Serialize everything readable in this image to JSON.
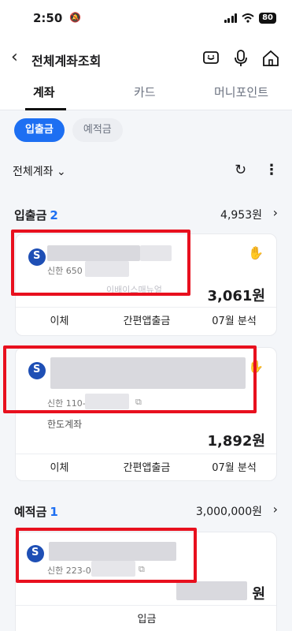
{
  "status_bar": {
    "time": "2:50",
    "battery": "80"
  },
  "header": {
    "title": "전체계좌조회"
  },
  "tabs": [
    {
      "label": "계좌"
    },
    {
      "label": "카드"
    },
    {
      "label": "머니포인트"
    }
  ],
  "chips": [
    {
      "label": "입출금"
    },
    {
      "label": "예적금"
    }
  ],
  "filter": {
    "label": "전체계좌"
  },
  "sections": {
    "checking": {
      "title": "입출금",
      "count": "2",
      "amount": "4,953원"
    },
    "savings": {
      "title": "예적금",
      "count": "1",
      "amount": "3,000,000원"
    }
  },
  "accounts": [
    {
      "number": "신한 650",
      "balance": "3,061원",
      "actions": [
        "이체",
        "간편앱출금",
        "07월 분석"
      ],
      "watermark": "이배이스매뉴얼"
    },
    {
      "number": "신한 110-",
      "sub": "한도계좌",
      "balance": "1,892원",
      "actions": [
        "이체",
        "간편앱출금",
        "07월 분석"
      ]
    },
    {
      "number": "신한 223-0",
      "balance_suffix": "원",
      "action": "입금"
    }
  ],
  "colors": {
    "accent": "#1d6ff2",
    "highlight": "#e8101e",
    "brand": "#1e4fb5"
  }
}
